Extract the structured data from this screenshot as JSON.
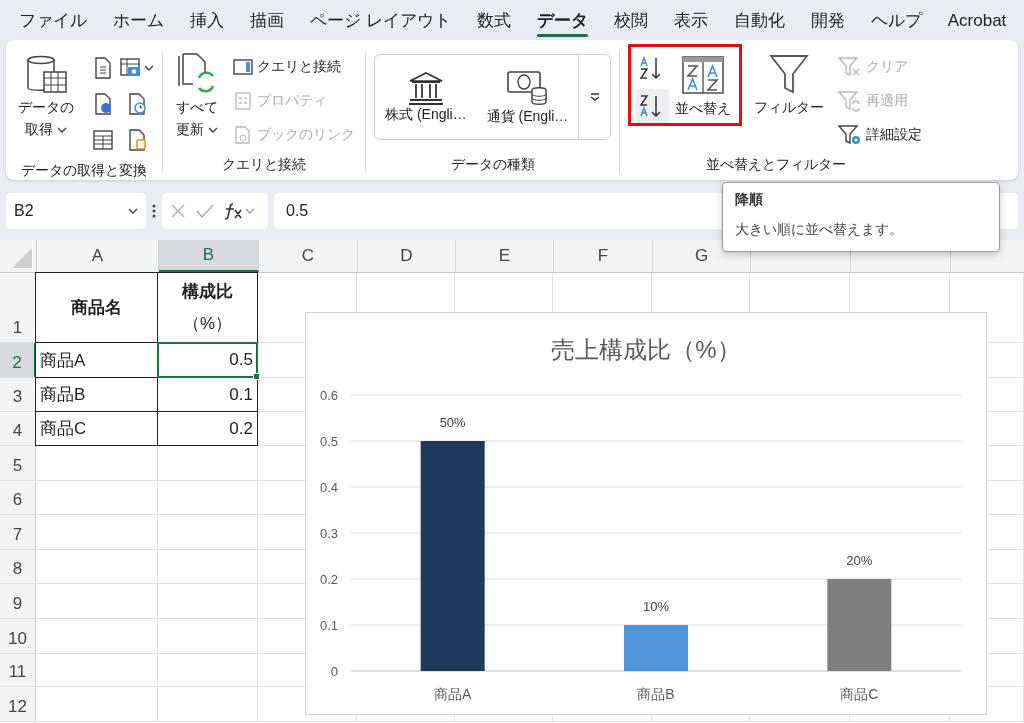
{
  "menu_tabs": [
    {
      "label": "ファイル",
      "selected": false
    },
    {
      "label": "ホーム",
      "selected": false
    },
    {
      "label": "挿入",
      "selected": false
    },
    {
      "label": "描画",
      "selected": false
    },
    {
      "label": "ページ レイアウト",
      "selected": false
    },
    {
      "label": "数式",
      "selected": false
    },
    {
      "label": "データ",
      "selected": true
    },
    {
      "label": "校閲",
      "selected": false
    },
    {
      "label": "表示",
      "selected": false
    },
    {
      "label": "自動化",
      "selected": false
    },
    {
      "label": "開発",
      "selected": false
    },
    {
      "label": "ヘルプ",
      "selected": false
    },
    {
      "label": "Acrobat",
      "selected": false
    }
  ],
  "ribbon": {
    "groups": [
      {
        "label": "データの取得と変換",
        "buttons": [
          {
            "kind": "large",
            "lines": [
              "データの",
              "取得"
            ],
            "dropdown": true,
            "disabled": false
          }
        ]
      },
      {
        "label": "クエリと接続",
        "buttons": [
          {
            "kind": "large",
            "lines": [
              "すべて",
              "更新"
            ],
            "dropdown": true,
            "disabled": false
          },
          {
            "kind": "small",
            "lines": [
              "クエリと接続"
            ],
            "dropdown": false,
            "disabled": false
          },
          {
            "kind": "small",
            "lines": [
              "プロパティ"
            ],
            "dropdown": false,
            "disabled": true
          },
          {
            "kind": "small",
            "lines": [
              "ブックのリンク"
            ],
            "dropdown": false,
            "disabled": true
          }
        ]
      },
      {
        "label": "データの種類",
        "buttons": [
          {
            "kind": "gallery",
            "lines": [
              "株式 (Engli…"
            ],
            "dropdown": false,
            "disabled": false
          },
          {
            "kind": "gallery",
            "lines": [
              "通貨 (Engli…"
            ],
            "dropdown": false,
            "disabled": false
          }
        ]
      },
      {
        "label": "並べ替えとフィルター",
        "highlighted": true,
        "buttons": [
          {
            "kind": "large",
            "lines": [
              "並べ替え"
            ],
            "dropdown": false,
            "disabled": false
          },
          {
            "kind": "large",
            "lines": [
              "フィルター"
            ],
            "dropdown": false,
            "disabled": false
          },
          {
            "kind": "small",
            "lines": [
              "クリア"
            ],
            "dropdown": false,
            "disabled": true
          },
          {
            "kind": "small",
            "lines": [
              "再適用"
            ],
            "dropdown": false,
            "disabled": true
          },
          {
            "kind": "small",
            "lines": [
              "詳細設定"
            ],
            "dropdown": false,
            "disabled": false
          }
        ]
      }
    ]
  },
  "formula_bar": {
    "name_box": "B2",
    "formula": "0.5"
  },
  "tooltip": {
    "title": "降順",
    "text": "大きい順に並べ替えます。"
  },
  "sheet": {
    "columns": [
      {
        "label": "A",
        "selected": false
      },
      {
        "label": "B",
        "selected": true
      },
      {
        "label": "C",
        "selected": false
      },
      {
        "label": "D",
        "selected": false
      },
      {
        "label": "E",
        "selected": false
      },
      {
        "label": "F",
        "selected": false
      },
      {
        "label": "G",
        "selected": false
      }
    ],
    "rows": [
      {
        "label": "1",
        "selected": false,
        "cells": [
          {
            "lines": [
              "商品名"
            ],
            "kind": "header",
            "selected": false
          },
          {
            "lines": [
              "構成比",
              "（%）"
            ],
            "kind": "header",
            "selected": false
          }
        ]
      },
      {
        "label": "2",
        "selected": true,
        "cells": [
          {
            "lines": [
              "商品A"
            ],
            "kind": "text",
            "selected": false
          },
          {
            "lines": [
              "0.5"
            ],
            "kind": "number",
            "selected": true
          }
        ]
      },
      {
        "label": "3",
        "selected": false,
        "cells": [
          {
            "lines": [
              "商品B"
            ],
            "kind": "text",
            "selected": false
          },
          {
            "lines": [
              "0.1"
            ],
            "kind": "number",
            "selected": false
          }
        ]
      },
      {
        "label": "4",
        "selected": false,
        "cells": [
          {
            "lines": [
              "商品C"
            ],
            "kind": "text",
            "selected": false
          },
          {
            "lines": [
              "0.2"
            ],
            "kind": "number",
            "selected": false
          }
        ]
      },
      {
        "label": "5",
        "selected": false,
        "cells": []
      },
      {
        "label": "6",
        "selected": false,
        "cells": []
      },
      {
        "label": "7",
        "selected": false,
        "cells": []
      },
      {
        "label": "8",
        "selected": false,
        "cells": []
      },
      {
        "label": "9",
        "selected": false,
        "cells": []
      },
      {
        "label": "10",
        "selected": false,
        "cells": []
      },
      {
        "label": "11",
        "selected": false,
        "cells": []
      },
      {
        "label": "12",
        "selected": false,
        "cells": []
      }
    ]
  },
  "chart": {
    "chart_data": {
      "type": "bar",
      "title": "売上構成比（%）",
      "categories": [
        "商品A",
        "商品B",
        "商品C"
      ],
      "grid": true,
      "series": [
        {
          "color": "#1b3a5c",
          "values": [
            0.5,
            null,
            null
          ]
        },
        {
          "color": "#4f93d8",
          "values": [
            null,
            0.1,
            null
          ]
        },
        {
          "color": "#7f7f7f",
          "values": [
            null,
            null,
            0.2
          ]
        }
      ],
      "ylim": [
        0,
        0.6
      ],
      "yticks": [
        0,
        0.1,
        0.2,
        0.3,
        0.4,
        0.5,
        0.6
      ],
      "value_labels": [
        "50%",
        "10%",
        "20%"
      ]
    }
  }
}
